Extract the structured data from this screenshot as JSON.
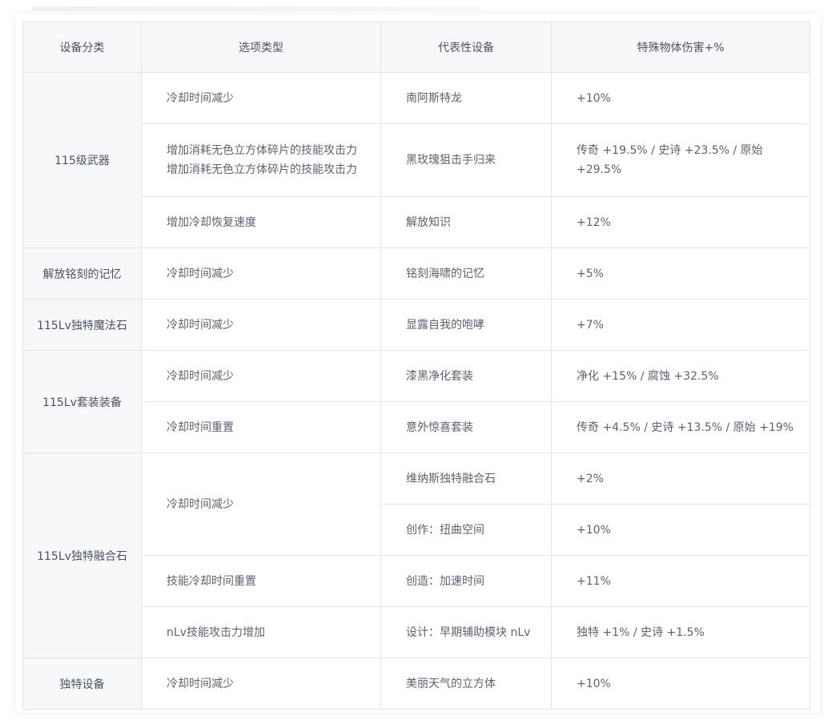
{
  "headers": [
    "设备分类",
    "选项类型",
    "代表性设备",
    "特殊物体伤害+%"
  ],
  "rows": [
    {
      "category": "115级武器",
      "option": "冷却时间减少",
      "device": "南阿斯特龙",
      "value": "+10%"
    },
    {
      "option_line1": "增加消耗无色立方体碎片的技能攻击力",
      "option_line2": "增加消耗无色立方体碎片的技能攻击力",
      "device": "黑玫瑰狙击手归来",
      "value": "传奇 +19.5% / 史诗 +23.5% / 原始 +29.5%"
    },
    {
      "option": "增加冷却恢复速度",
      "device": "解放知识",
      "value": "+12%"
    },
    {
      "category": "解放铭刻的记忆",
      "option": "冷却时间减少",
      "device": "铭刻海啸的记忆",
      "value": "+5%"
    },
    {
      "category": "115Lv独特魔法石",
      "option": "冷却时间减少",
      "device": "显露自我的咆哮",
      "value": "+7%"
    },
    {
      "category": "115Lv套装装备",
      "option": "冷却时间减少",
      "device": "漆黑净化套装",
      "value": "净化 +15% / 腐蚀 +32.5%"
    },
    {
      "option": "冷却时间重置",
      "device": "意外惊喜套装",
      "value": "传奇 +4.5% / 史诗 +13.5% / 原始 +19%"
    },
    {
      "category": "115Lv独特融合石",
      "option": "冷却时间减少",
      "device": "维纳斯独特融合石",
      "value": "+2%"
    },
    {
      "device": "创作：扭曲空间",
      "value": "+10%"
    },
    {
      "option": "技能冷却时间重置",
      "device": "创造：加速时间",
      "value": "+11%"
    },
    {
      "option": "nLv技能攻击力增加",
      "device": "设计：早期辅助模块 nLv",
      "value": "独特 +1% / 史诗 +1.5%"
    },
    {
      "category": "独特设备",
      "option": "冷却时间减少",
      "device": "美丽天气的立方体",
      "value": "+10%"
    }
  ]
}
